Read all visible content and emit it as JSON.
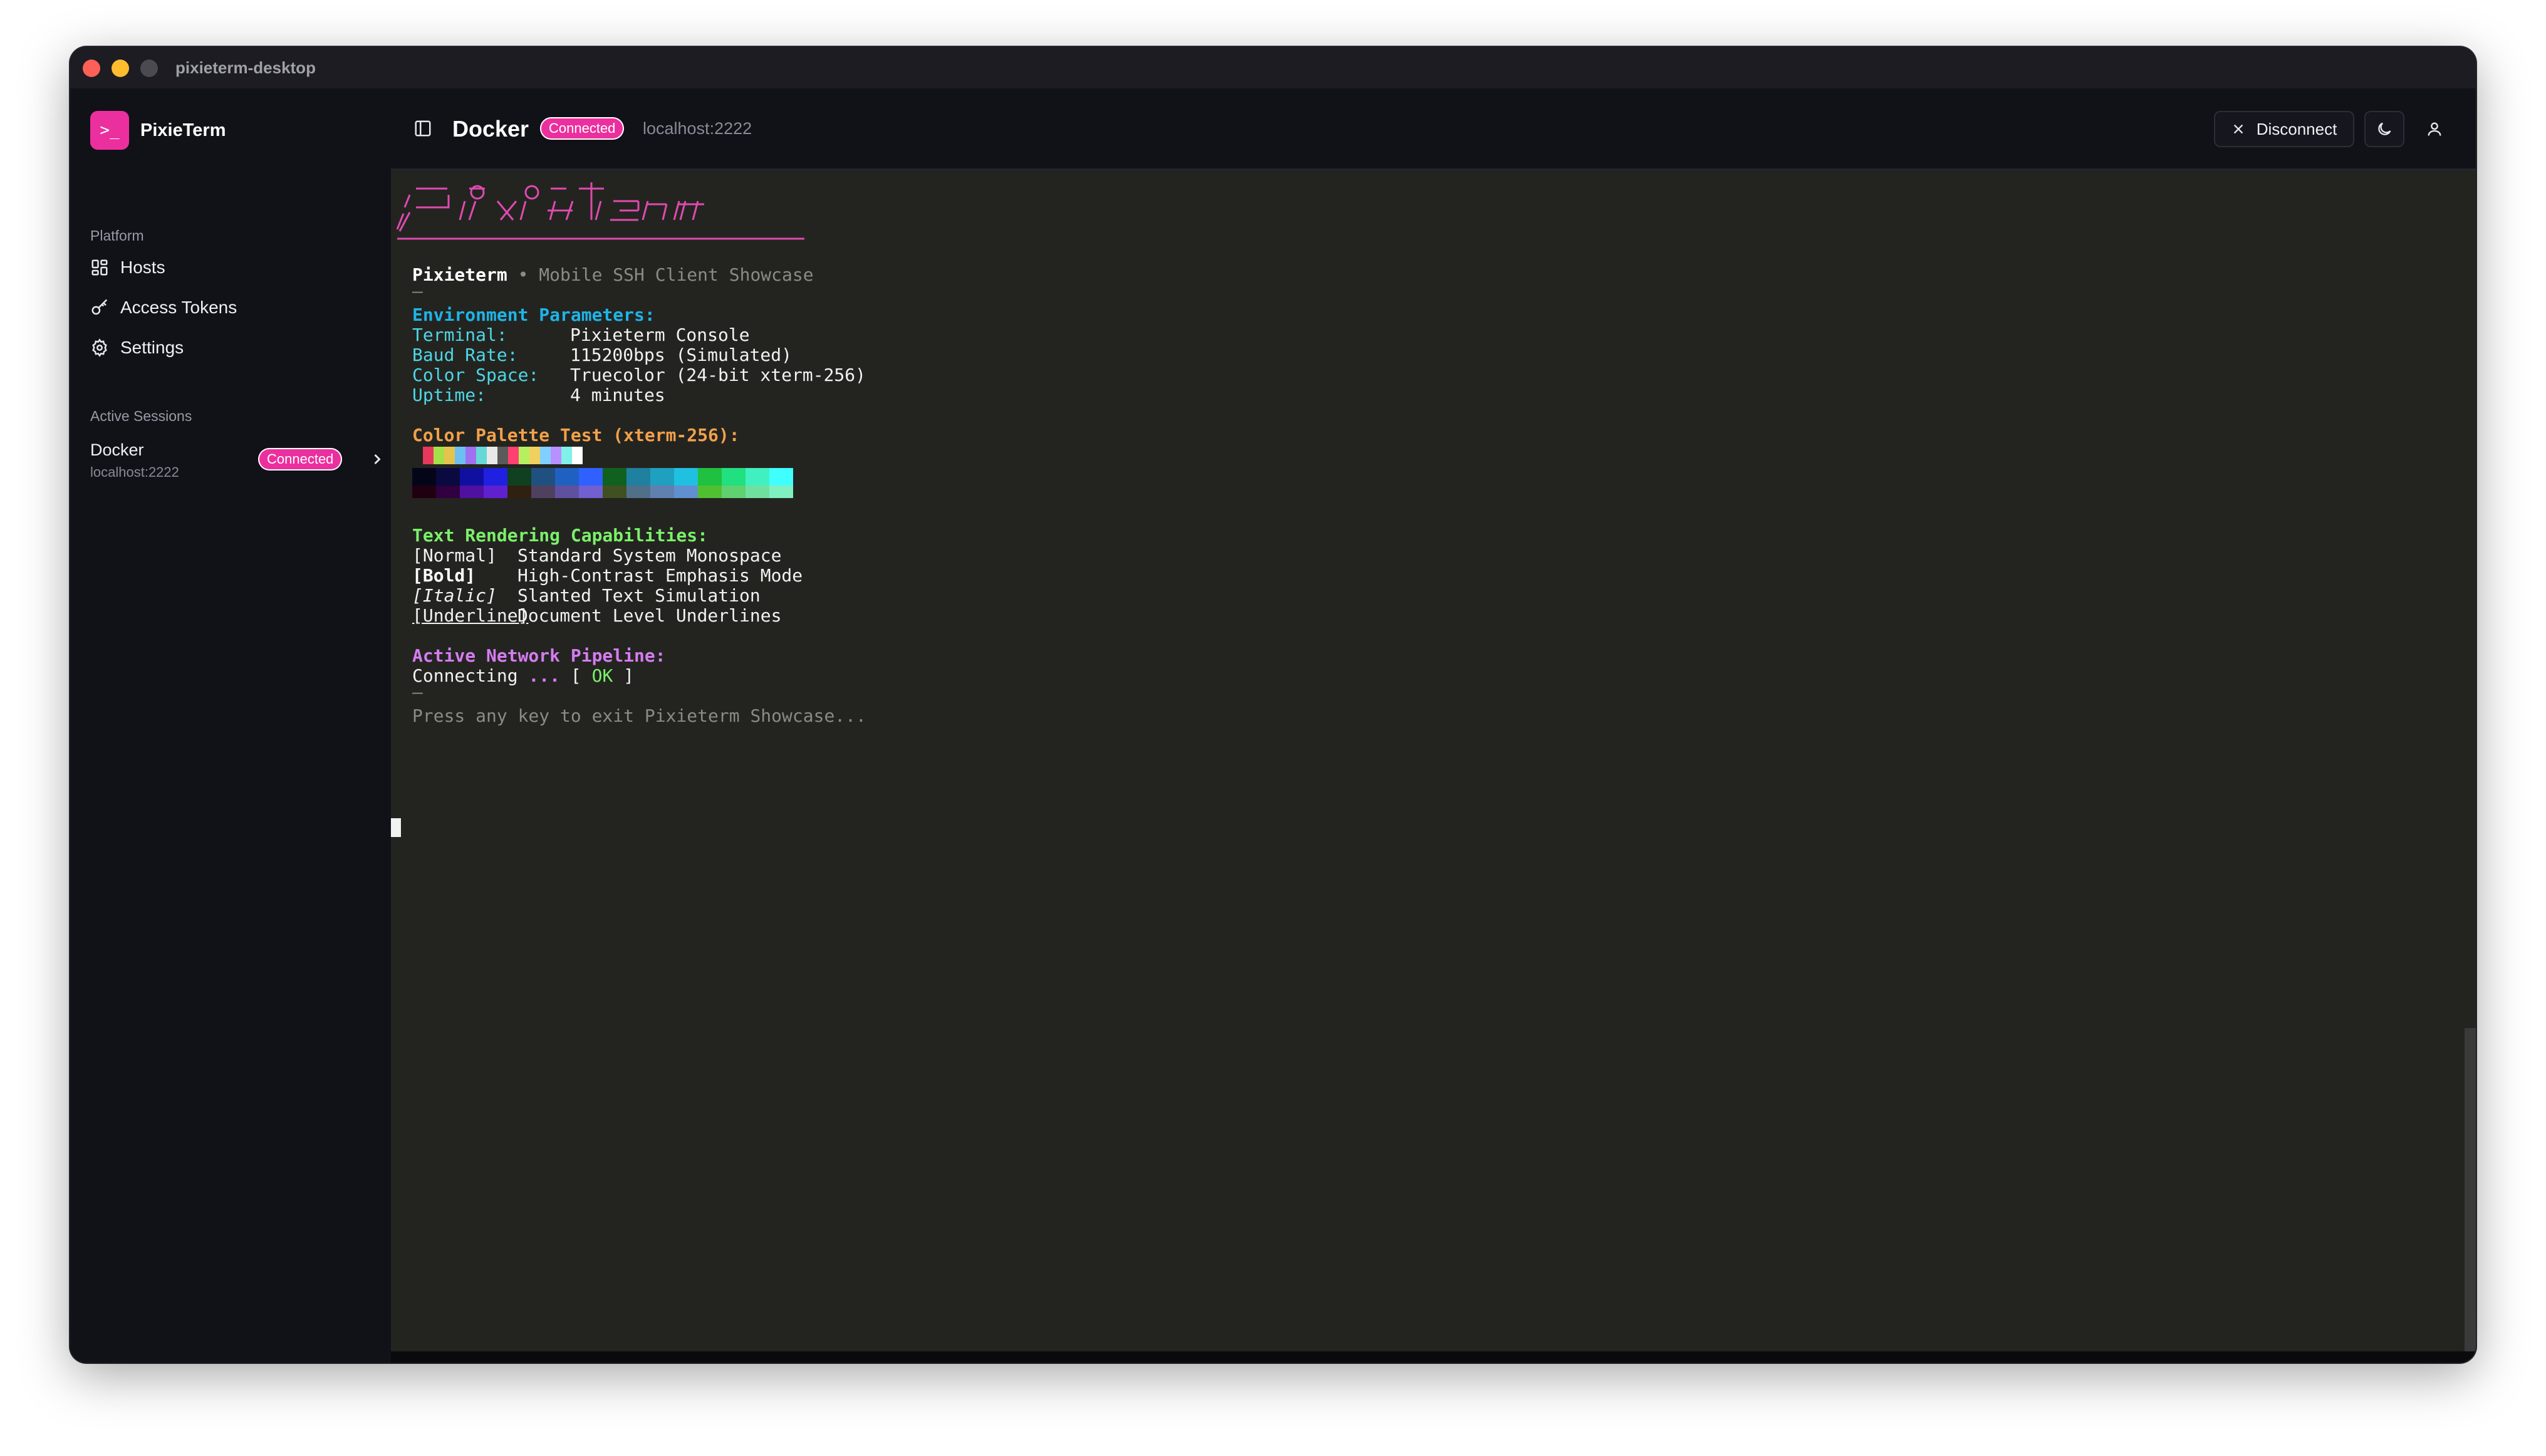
{
  "window": {
    "title": "pixieterm-desktop"
  },
  "sidebar": {
    "brand": {
      "name": "PixieTerm",
      "logo_glyph": ">_"
    },
    "platform_label": "Platform",
    "items": [
      {
        "label": "Hosts",
        "icon": "grid-icon"
      },
      {
        "label": "Access Tokens",
        "icon": "key-icon"
      },
      {
        "label": "Settings",
        "icon": "gear-icon"
      }
    ],
    "sessions_label": "Active Sessions",
    "sessions": [
      {
        "name": "Docker",
        "host": "localhost:2222",
        "status": "Connected"
      }
    ]
  },
  "header": {
    "name": "Docker",
    "status": "Connected",
    "host": "localhost:2222",
    "disconnect_label": "Disconnect"
  },
  "terminal": {
    "banner_brand": "Pixieterm",
    "banner_sep": " • ",
    "banner_sub": "Mobile SSH Client Showcase",
    "rule": "—",
    "env_heading": "Environment Parameters:",
    "env": [
      {
        "key": "Terminal:",
        "value": "Pixieterm Console"
      },
      {
        "key": "Baud Rate:",
        "value": "115200bps (Simulated)"
      },
      {
        "key": "Color Space:",
        "value": "Truecolor (24-bit xterm-256)"
      },
      {
        "key": "Uptime:",
        "value": "4 minutes"
      }
    ],
    "palette_heading": "Color Palette Test (xterm-256):",
    "text_heading": "Text Rendering Capabilities:",
    "styles": [
      {
        "tag": "[Normal]",
        "desc": "Standard System Monospace"
      },
      {
        "tag": "[Bold]",
        "desc": "High-Contrast Emphasis Mode"
      },
      {
        "tag": "[Italic]",
        "desc": "Slanted Text Simulation"
      },
      {
        "tag": "[Underline]",
        "desc": "Document Level Underlines"
      }
    ],
    "network_heading": "Active Network Pipeline:",
    "connecting": "Connecting",
    "dots": "...",
    "ok_open": "[ ",
    "ok": "OK",
    "ok_close": " ]",
    "exit_prompt": "Press any key to exit Pixieterm Showcase...",
    "palette_row1": [
      "#232420",
      "#e8385c",
      "#a4e04a",
      "#e6c34e",
      "#6cc0f0",
      "#a070f0",
      "#66d8d8",
      "#e8e8e8",
      "#5a5a5a",
      "#ff4070",
      "#b6f060",
      "#f0d060",
      "#80d0ff",
      "#b890ff",
      "#80f0e8",
      "#ffffff"
    ],
    "palette_row2": [
      "#05051a",
      "#0a0a40",
      "#1010a0",
      "#2020e0",
      "#104020",
      "#205080",
      "#2060c0",
      "#3060ff",
      "#106020",
      "#2080a0",
      "#20a0c0",
      "#20c0e0",
      "#20c040",
      "#20e080",
      "#40f0c0",
      "#40ffff"
    ],
    "palette_row3": [
      "#200010",
      "#300040",
      "#5010a0",
      "#6020d0",
      "#302010",
      "#504060",
      "#6050a0",
      "#7060d0",
      "#405020",
      "#50708a",
      "#6080b0",
      "#6090d0",
      "#50c030",
      "#60d070",
      "#70e0a0",
      "#80f0c0"
    ]
  }
}
